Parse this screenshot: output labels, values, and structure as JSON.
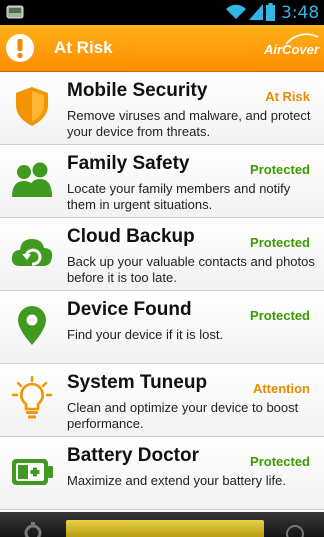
{
  "status_bar": {
    "time": "3:48",
    "icons": [
      "notification-app-icon",
      "wifi-icon",
      "signal-icon",
      "battery-icon"
    ]
  },
  "header": {
    "title": "At Risk",
    "brand": "AirCover",
    "alert_icon": "warning-exclamation-icon"
  },
  "colors": {
    "header": "#ff9a00",
    "at_risk": "#e78b00",
    "protected": "#3d9b00",
    "attention": "#e78b00",
    "icon_green": "#3f9a1f"
  },
  "items": [
    {
      "title": "Mobile Security",
      "description": "Remove viruses and malware, and protect your device from threats.",
      "status": "At Risk",
      "icon": "shield-icon"
    },
    {
      "title": "Family Safety",
      "description": "Locate your family members and notify them in urgent situations.",
      "status": "Protected",
      "icon": "family-icon"
    },
    {
      "title": "Cloud Backup",
      "description": "Back up your valuable contacts and photos before it is too late.",
      "status": "Protected",
      "icon": "cloud-backup-icon"
    },
    {
      "title": "Device Found",
      "description": "Find your device if it is lost.",
      "status": "Protected",
      "icon": "location-pin-icon"
    },
    {
      "title": "System Tuneup",
      "description": "Clean and optimize your device to boost performance.",
      "status": "Attention",
      "icon": "lightbulb-icon"
    },
    {
      "title": "Battery Doctor",
      "description": "Maximize and extend your battery life.",
      "status": "Protected",
      "icon": "battery-doctor-icon"
    }
  ],
  "bottom_bar": {
    "icons": [
      "gear-icon",
      "help-icon"
    ]
  }
}
